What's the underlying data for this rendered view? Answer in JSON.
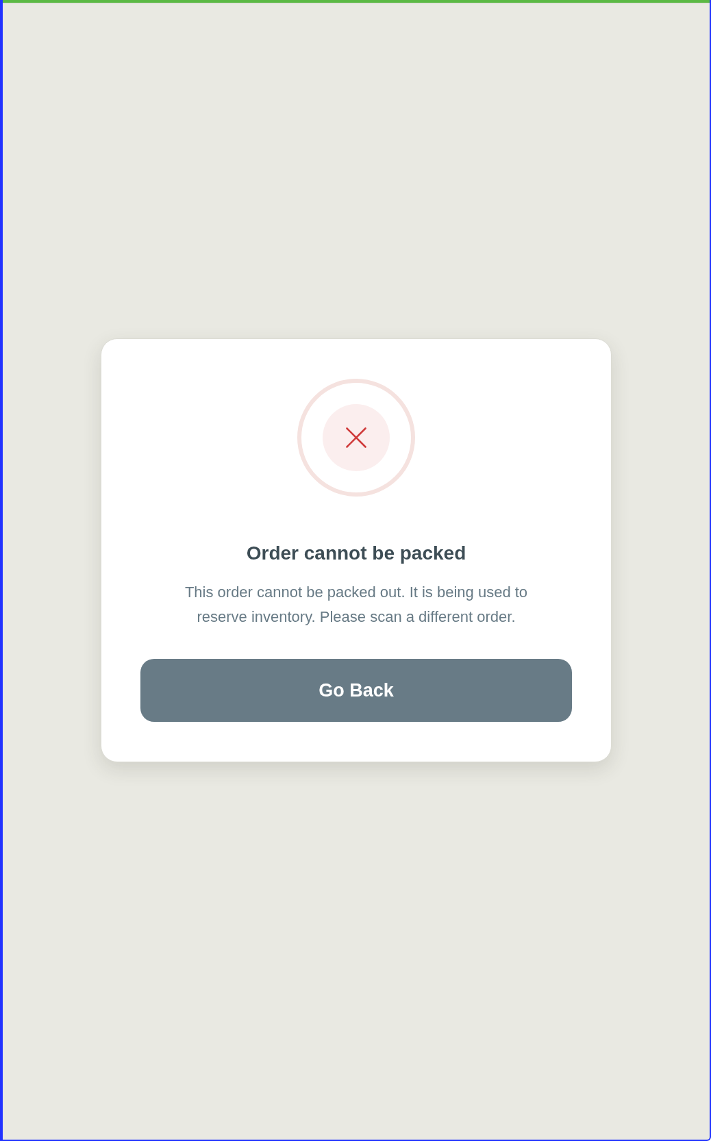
{
  "dialog": {
    "kind": "error",
    "title": "Order cannot be packed",
    "message": "This order cannot be packed out. It is being used to reserve inventory. Please scan a different order.",
    "buttons": [
      {
        "label": "Go Back"
      }
    ]
  }
}
